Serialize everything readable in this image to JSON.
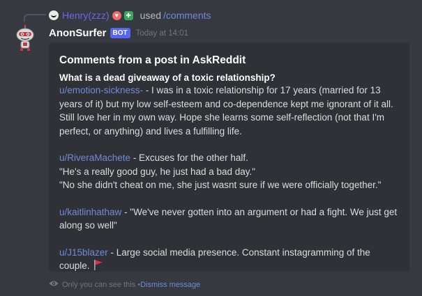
{
  "command": {
    "user": "Henry(zzz)",
    "used_text": "used",
    "command_name": "/comments"
  },
  "message": {
    "author": "AnonSurfer",
    "bot_tag": "BOT",
    "timestamp": "Today at 14:01"
  },
  "embed": {
    "title": "Comments from a post in AskReddit",
    "question": "What is a dead giveaway of a toxic relationship?",
    "comments": [
      {
        "user": "u/emotion-sickness-",
        "text": " - I was in a toxic relationship for 17 years (married for 13 years of it) but my low self-esteem and co-dependence kept me ignorant of it all. Still love her in my own way. Hope she learns some self-reflection (not that I'm perfect, or anything) and lives a fulfilling life."
      },
      {
        "user": "u/RiveraMachete",
        "lines": [
          " - Excuses for the other half.",
          "\"He's a really good guy, he just had a bad day.\"",
          "\"No she didn't cheat on me, she just wasnt sure if we were officially together.\""
        ]
      },
      {
        "user": "u/kaitlinhathaw",
        "text": " - \"We've never gotten into an argument or had a fight. We just get along so well\""
      },
      {
        "user": "u/J15blazer",
        "text": " - Large social media presence. Constant instagramming of the couple.",
        "icon": "red-flag-icon"
      }
    ]
  },
  "ephemeral": {
    "notice": "Only you can see this • ",
    "dismiss": "Dismiss message"
  },
  "colors": {
    "background": "#36393f",
    "embed": "#2f3136",
    "link": "#7289da",
    "bot_tag": "#5865f2"
  }
}
